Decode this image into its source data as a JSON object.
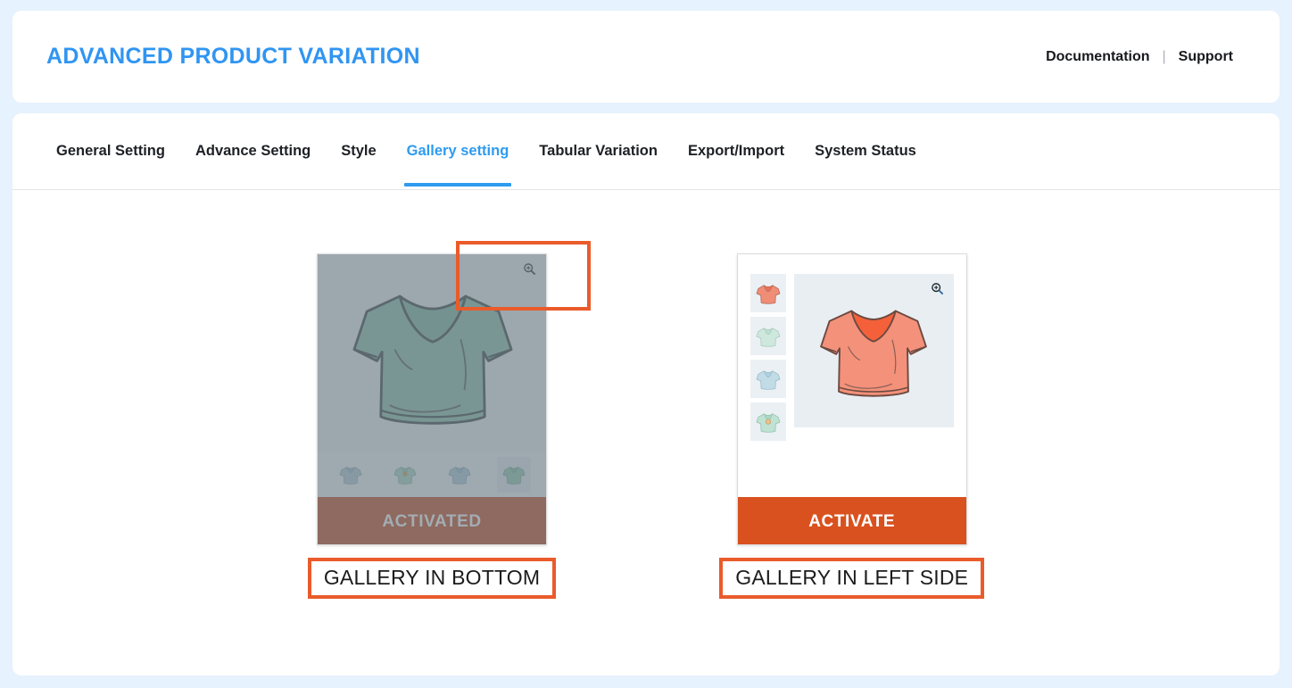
{
  "header": {
    "title": "ADVANCED PRODUCT VARIATION",
    "links": [
      {
        "label": "Documentation"
      },
      {
        "label": "Support"
      }
    ],
    "separator": "|",
    "accent_color": "#3095f2"
  },
  "tabs": [
    {
      "label": "General Setting",
      "active": false
    },
    {
      "label": "Advance Setting",
      "active": false
    },
    {
      "label": "Style",
      "active": false
    },
    {
      "label": "Gallery setting",
      "active": true
    },
    {
      "label": "Tabular Variation",
      "active": false
    },
    {
      "label": "Export/Import",
      "active": false
    },
    {
      "label": "System Status",
      "active": false
    }
  ],
  "gallery_options": [
    {
      "caption": "GALLERY IN BOTTOM",
      "button_label": "ACTIVATED",
      "state": "activated",
      "layout": "bottom",
      "button_color": "#c64d22",
      "main_shirt_color": "#8fc3af",
      "thumbnails": [
        {
          "color": "#b3cdd8",
          "selected": false,
          "badge": false
        },
        {
          "color": "#a9d8c4",
          "selected": false,
          "badge": true
        },
        {
          "color": "#b0cedc",
          "selected": false,
          "badge": false
        },
        {
          "color": "#97ccb4",
          "selected": true,
          "badge": false
        }
      ]
    },
    {
      "caption": "GALLERY IN LEFT SIDE",
      "button_label": "ACTIVATE",
      "state": "inactive",
      "layout": "left",
      "button_color": "#d9511f",
      "main_shirt_color": "#f4917a",
      "thumbnails": [
        {
          "color": "#ef8d76",
          "selected": true,
          "badge": false
        },
        {
          "color": "#cfe8dd",
          "selected": false,
          "badge": false
        },
        {
          "color": "#c2dce7",
          "selected": false,
          "badge": false
        },
        {
          "color": "#bfe2d3",
          "selected": false,
          "badge": true
        }
      ]
    }
  ],
  "icons": {
    "zoom": "magnifier-plus-icon"
  },
  "colors": {
    "page_background": "#e6f2fd",
    "card_background": "#ffffff",
    "annotation_border": "#ea5b2b",
    "tab_active": "#2e9bf0"
  }
}
